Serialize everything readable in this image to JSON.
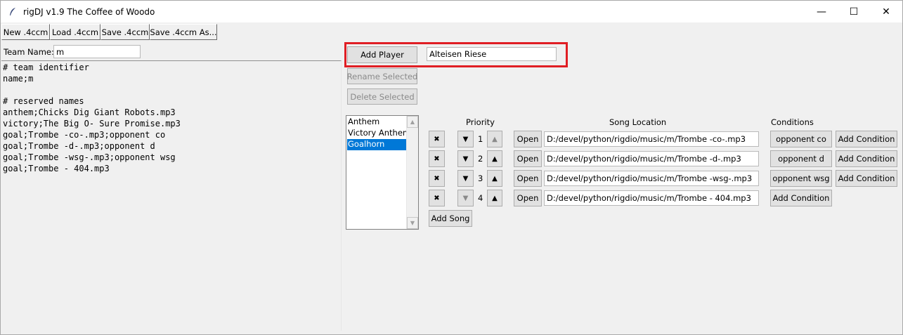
{
  "window": {
    "title": "rigDJ v1.9 The Coffee of Woodo",
    "minimize_glyph": "—",
    "maximize_glyph": "☐",
    "close_glyph": "✕"
  },
  "toolbar": {
    "new_label": "New .4ccm",
    "load_label": "Load .4ccm",
    "save_label": "Save .4ccm",
    "save_as_label": "Save .4ccm As..."
  },
  "team": {
    "name_label": "Team Name:",
    "name_value": "m"
  },
  "editor": {
    "lines": [
      "# team identifier",
      "name;m",
      "",
      "# reserved names",
      "anthem;Chicks Dig Giant Robots.mp3",
      "victory;The Big O- Sure Promise.mp3",
      "goal;Trombe -co-.mp3;opponent co",
      "goal;Trombe -d-.mp3;opponent d",
      "goal;Trombe -wsg-.mp3;opponent wsg",
      "goal;Trombe - 404.mp3"
    ]
  },
  "player": {
    "add_label": "Add Player",
    "name_value": "Alteisen Riese",
    "rename_label": "Rename Selected",
    "delete_label": "Delete Selected"
  },
  "players_list": {
    "items": [
      "Anthem",
      "Victory Anthem",
      "Goalhorn"
    ],
    "selected_index": 2
  },
  "songs": {
    "headers": {
      "priority": "Priority",
      "location": "Song Location",
      "conditions": "Conditions"
    },
    "delete_glyph": "✖",
    "down_glyph": "▼",
    "up_glyph": "▲",
    "open_label": "Open",
    "add_condition_label": "Add Condition",
    "add_song_label": "Add Song",
    "rows": [
      {
        "priority": "1",
        "location": "D:/devel/python/rigdio/music/m/Trombe -co-.mp3",
        "condition": "opponent co"
      },
      {
        "priority": "2",
        "location": "D:/devel/python/rigdio/music/m/Trombe -d-.mp3",
        "condition": "opponent d"
      },
      {
        "priority": "3",
        "location": "D:/devel/python/rigdio/music/m/Trombe -wsg-.mp3",
        "condition": "opponent wsg"
      },
      {
        "priority": "4",
        "location": "D:/devel/python/rigdio/music/m/Trombe - 404.mp3",
        "condition": ""
      }
    ]
  },
  "colors": {
    "highlight": "#e01e24",
    "selection": "#0078d7"
  }
}
